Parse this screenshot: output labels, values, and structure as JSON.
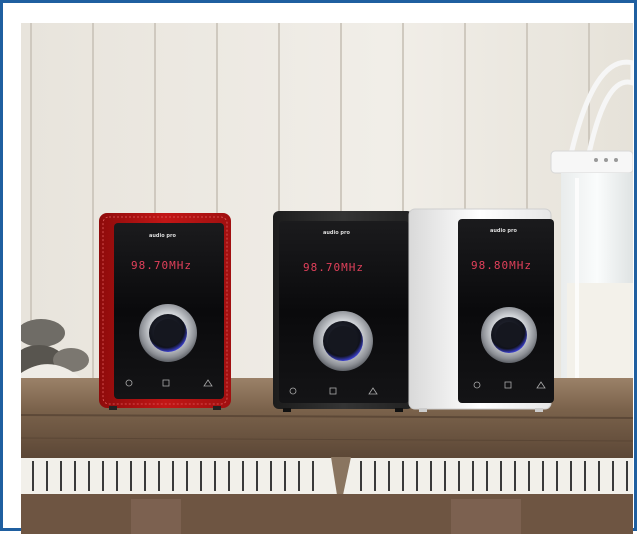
{
  "frame": {
    "border_color": "#1f5fa0"
  },
  "scene": {
    "wall_color": "#ece9e2",
    "table_color": "#8a7158",
    "crate_color": "#6e5542"
  },
  "speakers": [
    {
      "name": "red",
      "body_color": "#b01212",
      "brand": "audio pro",
      "display": "98.70MHz"
    },
    {
      "name": "black",
      "body_color": "#2a2a2a",
      "brand": "audio pro",
      "display": "98.70MHz"
    },
    {
      "name": "white",
      "body_color": "#f4f4f4",
      "brand": "audio pro",
      "display": "98.80MHz"
    }
  ],
  "icons": {
    "power": "power-icon",
    "source": "source-icon",
    "network": "network-icon"
  }
}
